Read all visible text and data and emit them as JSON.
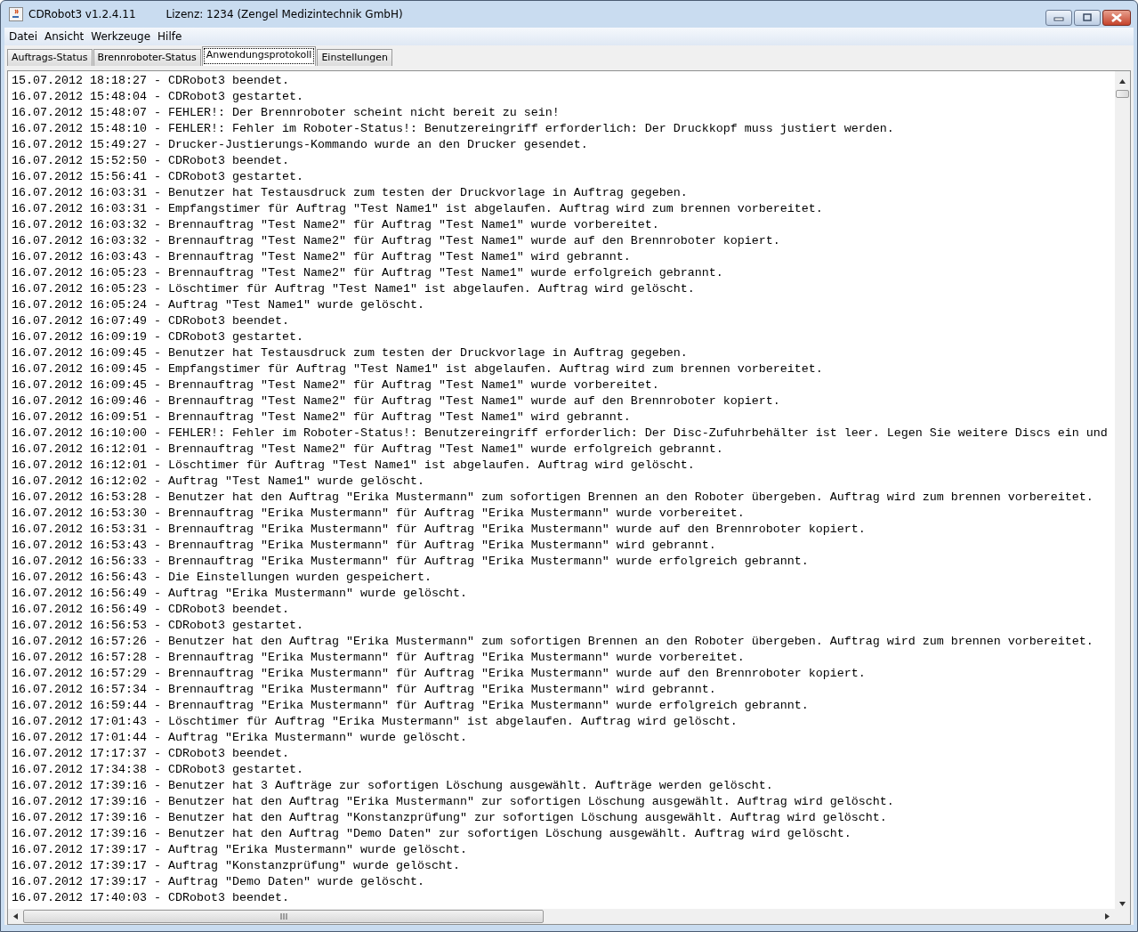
{
  "window": {
    "title": "CDRobot3 v1.2.4.11",
    "license": "Lizenz:  1234 (Zengel Medizintechnik GmbH)"
  },
  "menu": [
    "Datei",
    "Ansicht",
    "Werkzeuge",
    "Hilfe"
  ],
  "tabs": [
    {
      "label": "Auftrags-Status",
      "selected": false
    },
    {
      "label": "Brennroboter-Status",
      "selected": false
    },
    {
      "label": "Anwendungsprotokoll",
      "selected": true
    },
    {
      "label": "Einstellungen",
      "selected": false
    }
  ],
  "log": [
    "15.07.2012 18:18:27 - CDRobot3 beendet.",
    "16.07.2012 15:48:04 - CDRobot3 gestartet.",
    "16.07.2012 15:48:07 - FEHLER!: Der Brennroboter scheint nicht bereit zu sein!",
    "16.07.2012 15:48:10 - FEHLER!: Fehler im Roboter-Status!: Benutzereingriff erforderlich: Der Druckkopf muss justiert werden.",
    "16.07.2012 15:49:27 - Drucker-Justierungs-Kommando wurde an den Drucker gesendet.",
    "16.07.2012 15:52:50 - CDRobot3 beendet.",
    "16.07.2012 15:56:41 - CDRobot3 gestartet.",
    "16.07.2012 16:03:31 - Benutzer hat Testausdruck zum testen der Druckvorlage in Auftrag gegeben.",
    "16.07.2012 16:03:31 - Empfangstimer für Auftrag \"Test Name1\" ist abgelaufen. Auftrag wird zum brennen vorbereitet.",
    "16.07.2012 16:03:32 - Brennauftrag \"Test Name2\" für Auftrag \"Test Name1\" wurde vorbereitet.",
    "16.07.2012 16:03:32 - Brennauftrag \"Test Name2\" für Auftrag \"Test Name1\" wurde auf den Brennroboter kopiert.",
    "16.07.2012 16:03:43 - Brennauftrag \"Test Name2\" für Auftrag \"Test Name1\" wird gebrannt.",
    "16.07.2012 16:05:23 - Brennauftrag \"Test Name2\" für Auftrag \"Test Name1\" wurde erfolgreich gebrannt.",
    "16.07.2012 16:05:23 - Löschtimer für Auftrag \"Test Name1\" ist abgelaufen. Auftrag wird gelöscht.",
    "16.07.2012 16:05:24 - Auftrag \"Test Name1\" wurde gelöscht.",
    "16.07.2012 16:07:49 - CDRobot3 beendet.",
    "16.07.2012 16:09:19 - CDRobot3 gestartet.",
    "16.07.2012 16:09:45 - Benutzer hat Testausdruck zum testen der Druckvorlage in Auftrag gegeben.",
    "16.07.2012 16:09:45 - Empfangstimer für Auftrag \"Test Name1\" ist abgelaufen. Auftrag wird zum brennen vorbereitet.",
    "16.07.2012 16:09:45 - Brennauftrag \"Test Name2\" für Auftrag \"Test Name1\" wurde vorbereitet.",
    "16.07.2012 16:09:46 - Brennauftrag \"Test Name2\" für Auftrag \"Test Name1\" wurde auf den Brennroboter kopiert.",
    "16.07.2012 16:09:51 - Brennauftrag \"Test Name2\" für Auftrag \"Test Name1\" wird gebrannt.",
    "16.07.2012 16:10:00 - FEHLER!: Fehler im Roboter-Status!: Benutzereingriff erforderlich: Der Disc-Zufuhrbehälter ist leer. Legen Sie weitere Discs ein und",
    "16.07.2012 16:12:01 - Brennauftrag \"Test Name2\" für Auftrag \"Test Name1\" wurde erfolgreich gebrannt.",
    "16.07.2012 16:12:01 - Löschtimer für Auftrag \"Test Name1\" ist abgelaufen. Auftrag wird gelöscht.",
    "16.07.2012 16:12:02 - Auftrag \"Test Name1\" wurde gelöscht.",
    "16.07.2012 16:53:28 - Benutzer hat den Auftrag \"Erika Mustermann\" zum sofortigen Brennen an den Roboter übergeben. Auftrag wird zum brennen vorbereitet.",
    "16.07.2012 16:53:30 - Brennauftrag \"Erika Mustermann\" für Auftrag \"Erika Mustermann\" wurde vorbereitet.",
    "16.07.2012 16:53:31 - Brennauftrag \"Erika Mustermann\" für Auftrag \"Erika Mustermann\" wurde auf den Brennroboter kopiert.",
    "16.07.2012 16:53:43 - Brennauftrag \"Erika Mustermann\" für Auftrag \"Erika Mustermann\" wird gebrannt.",
    "16.07.2012 16:56:33 - Brennauftrag \"Erika Mustermann\" für Auftrag \"Erika Mustermann\" wurde erfolgreich gebrannt.",
    "16.07.2012 16:56:43 - Die Einstellungen wurden gespeichert.",
    "16.07.2012 16:56:49 - Auftrag \"Erika Mustermann\" wurde gelöscht.",
    "16.07.2012 16:56:49 - CDRobot3 beendet.",
    "16.07.2012 16:56:53 - CDRobot3 gestartet.",
    "16.07.2012 16:57:26 - Benutzer hat den Auftrag \"Erika Mustermann\" zum sofortigen Brennen an den Roboter übergeben. Auftrag wird zum brennen vorbereitet.",
    "16.07.2012 16:57:28 - Brennauftrag \"Erika Mustermann\" für Auftrag \"Erika Mustermann\" wurde vorbereitet.",
    "16.07.2012 16:57:29 - Brennauftrag \"Erika Mustermann\" für Auftrag \"Erika Mustermann\" wurde auf den Brennroboter kopiert.",
    "16.07.2012 16:57:34 - Brennauftrag \"Erika Mustermann\" für Auftrag \"Erika Mustermann\" wird gebrannt.",
    "16.07.2012 16:59:44 - Brennauftrag \"Erika Mustermann\" für Auftrag \"Erika Mustermann\" wurde erfolgreich gebrannt.",
    "16.07.2012 17:01:43 - Löschtimer für Auftrag \"Erika Mustermann\" ist abgelaufen. Auftrag wird gelöscht.",
    "16.07.2012 17:01:44 - Auftrag \"Erika Mustermann\" wurde gelöscht.",
    "16.07.2012 17:17:37 - CDRobot3 beendet.",
    "16.07.2012 17:34:38 - CDRobot3 gestartet.",
    "16.07.2012 17:39:16 - Benutzer hat 3 Aufträge zur sofortigen Löschung ausgewählt. Aufträge werden gelöscht.",
    "16.07.2012 17:39:16 - Benutzer hat den Auftrag \"Erika Mustermann\" zur sofortigen Löschung ausgewählt. Auftrag wird gelöscht.",
    "16.07.2012 17:39:16 - Benutzer hat den Auftrag \"Konstanzprüfung\" zur sofortigen Löschung ausgewählt. Auftrag wird gelöscht.",
    "16.07.2012 17:39:16 - Benutzer hat den Auftrag \"Demo Daten\" zur sofortigen Löschung ausgewählt. Auftrag wird gelöscht.",
    "16.07.2012 17:39:17 - Auftrag \"Erika Mustermann\" wurde gelöscht.",
    "16.07.2012 17:39:17 - Auftrag \"Konstanzprüfung\" wurde gelöscht.",
    "16.07.2012 17:39:17 - Auftrag \"Demo Daten\" wurde gelöscht.",
    "16.07.2012 17:40:03 - CDRobot3 beendet."
  ]
}
